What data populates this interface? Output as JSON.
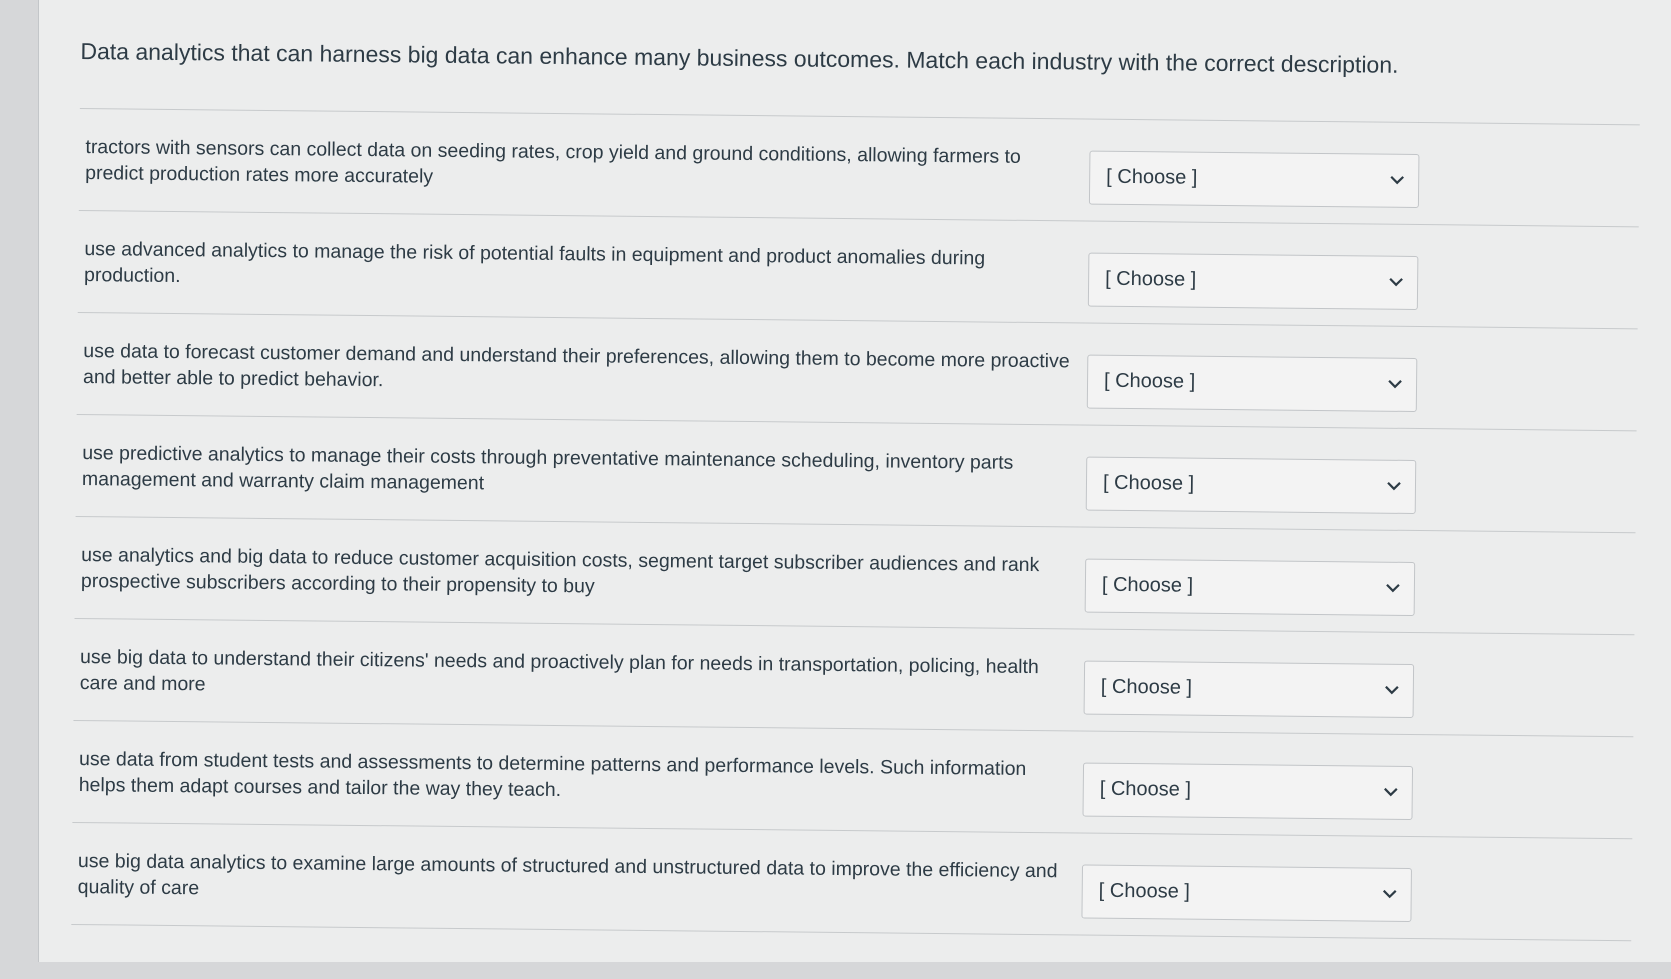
{
  "question": {
    "prompt": "Data analytics that can harness big data can enhance many business outcomes. Match each industry with the correct description."
  },
  "rows": [
    {
      "description": "tractors with sensors can collect data on seeding rates, crop yield and ground conditions, allowing farmers to predict production rates more accurately",
      "selected": "[ Choose ]"
    },
    {
      "description": "use advanced analytics to manage the risk of potential faults in equipment and product anomalies during production.",
      "selected": "[ Choose ]"
    },
    {
      "description": "use data to forecast customer demand and understand their preferences, allowing them to become more proactive and better able to predict behavior.",
      "selected": "[ Choose ]"
    },
    {
      "description": "use predictive analytics to manage their costs through preventative maintenance scheduling, inventory parts management and warranty claim management",
      "selected": "[ Choose ]"
    },
    {
      "description": "use analytics and big data to reduce customer acquisition costs, segment target subscriber audiences and rank prospective subscribers according to their propensity to buy",
      "selected": "[ Choose ]"
    },
    {
      "description": "use big data to understand their citizens' needs and proactively plan for needs in transportation, policing, health care and more",
      "selected": "[ Choose ]"
    },
    {
      "description": "use data from student tests and assessments to determine patterns and performance levels. Such information helps them adapt courses and tailor the way they teach.",
      "selected": "[ Choose ]"
    },
    {
      "description": "use big data analytics to examine large amounts of structured and unstructured data to improve the efficiency and quality of care",
      "selected": "[ Choose ]"
    }
  ],
  "icons": {
    "dropdown": "chevron-down-icon"
  }
}
